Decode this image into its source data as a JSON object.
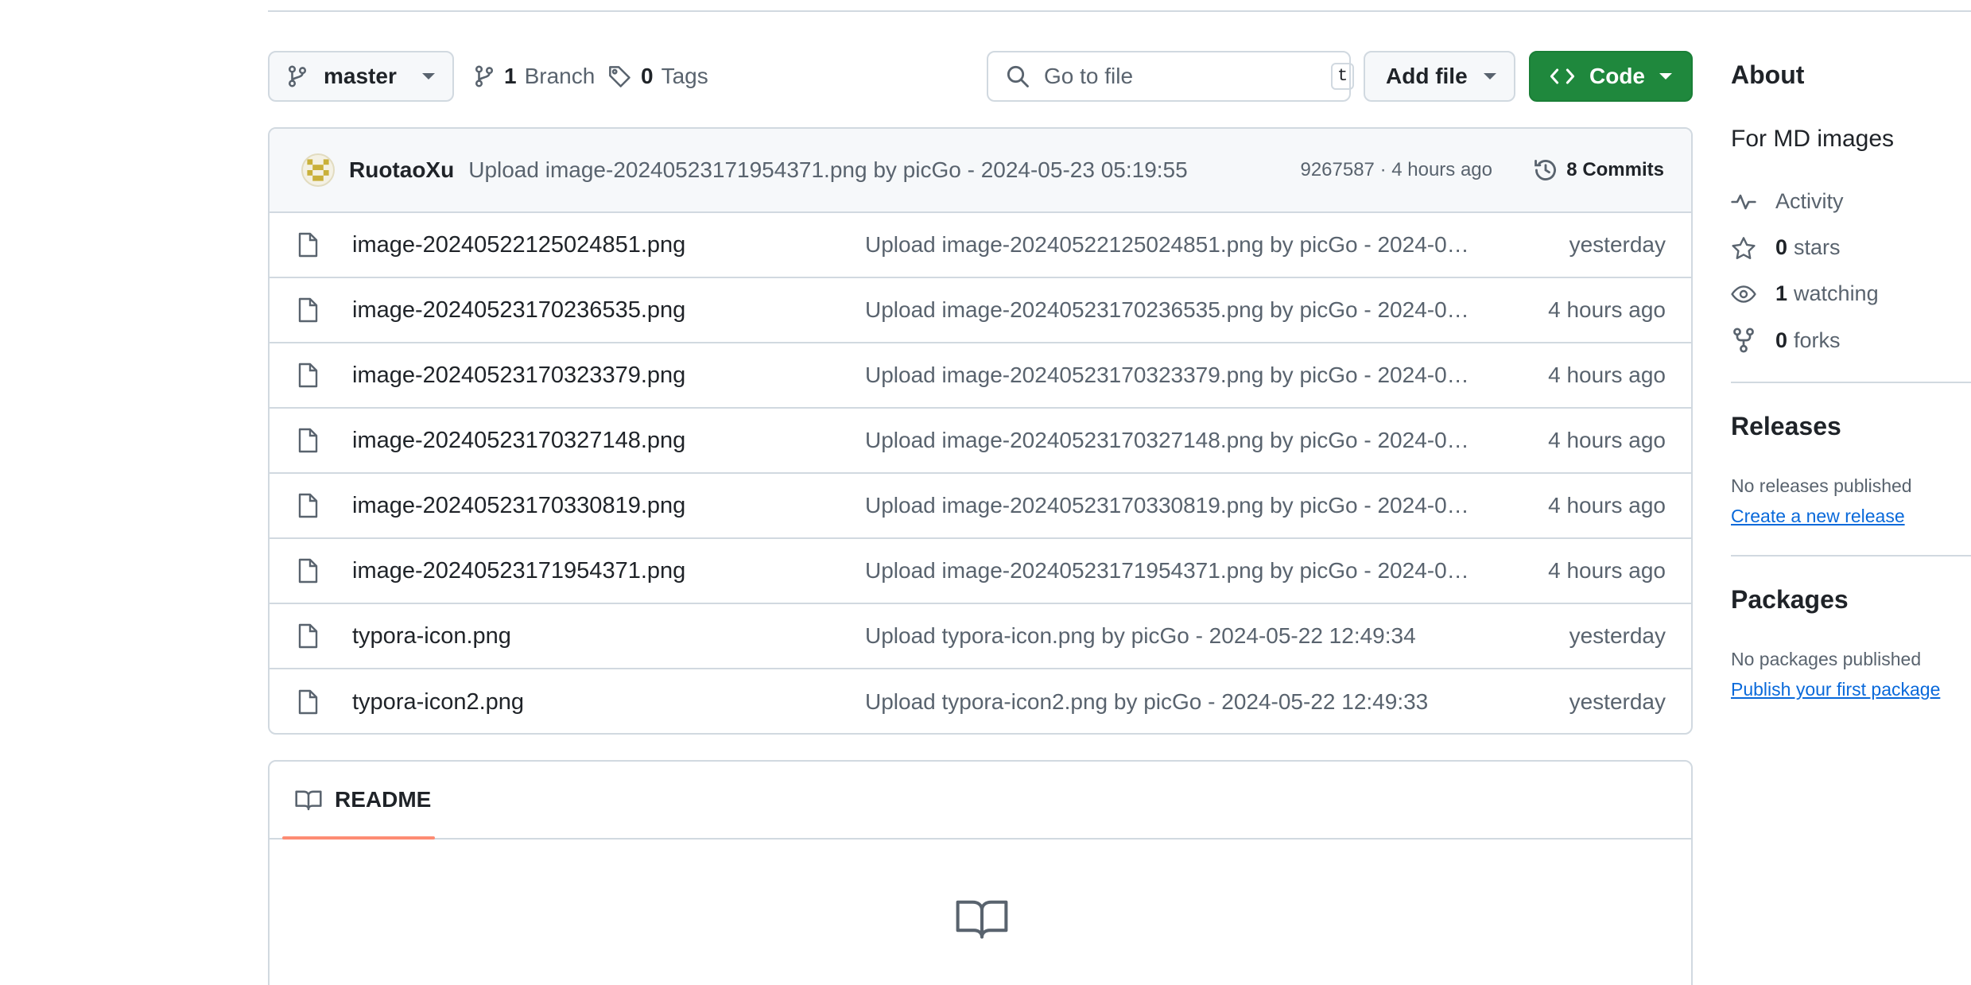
{
  "toolbar": {
    "branch_name": "master",
    "branch_count": "1",
    "branch_label": "Branch",
    "tag_count": "0",
    "tag_label": "Tags",
    "search_placeholder": "Go to file",
    "search_shortcut": "t",
    "add_file_label": "Add file",
    "code_label": "Code",
    "code_color": "#1f883d"
  },
  "latest_commit": {
    "author": "RuotaoXu",
    "message": "Upload image-20240523171954371.png by picGo - 2024-05-23 05:19:55",
    "meta": "9267587 · 4 hours ago",
    "commits_count_label": "8 Commits"
  },
  "files": [
    {
      "name": "image-20240522125024851.png",
      "message": "Upload image-20240522125024851.png by picGo - 2024-05...",
      "age": "yesterday",
      "icon": "file-icon"
    },
    {
      "name": "image-20240523170236535.png",
      "message": "Upload image-20240523170236535.png by picGo - 2024-05...",
      "age": "4 hours ago",
      "icon": "file-icon"
    },
    {
      "name": "image-20240523170323379.png",
      "message": "Upload image-20240523170323379.png by picGo - 2024-05...",
      "age": "4 hours ago",
      "icon": "file-icon"
    },
    {
      "name": "image-20240523170327148.png",
      "message": "Upload image-20240523170327148.png by picGo - 2024-05...",
      "age": "4 hours ago",
      "icon": "file-icon"
    },
    {
      "name": "image-20240523170330819.png",
      "message": "Upload image-20240523170330819.png by picGo - 2024-05...",
      "age": "4 hours ago",
      "icon": "file-icon"
    },
    {
      "name": "image-20240523171954371.png",
      "message": "Upload image-20240523171954371.png by picGo - 2024-05...",
      "age": "4 hours ago",
      "icon": "file-icon"
    },
    {
      "name": "typora-icon.png",
      "message": "Upload typora-icon.png by picGo - 2024-05-22 12:49:34",
      "age": "yesterday",
      "icon": "file-icon"
    },
    {
      "name": "typora-icon2.png",
      "message": "Upload typora-icon2.png by picGo - 2024-05-22 12:49:33",
      "age": "yesterday",
      "icon": "file-icon"
    }
  ],
  "readme": {
    "tab_label": "README"
  },
  "sidebar": {
    "about_title": "About",
    "description": "For MD images",
    "activity_label": "Activity",
    "stars_count": "0",
    "stars_label": "stars",
    "watching_count": "1",
    "watching_label": "watching",
    "forks_count": "0",
    "forks_label": "forks",
    "releases_title": "Releases",
    "releases_empty": "No releases published",
    "releases_link": "Create a new release",
    "packages_title": "Packages",
    "packages_empty": "No packages published",
    "packages_link": "Publish your first package",
    "link_color": "#0969da"
  }
}
